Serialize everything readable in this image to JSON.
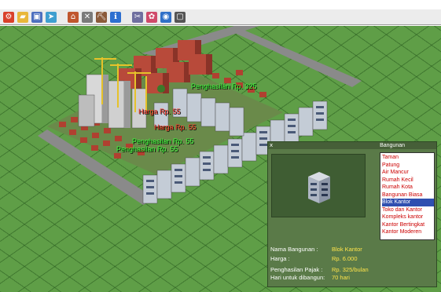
{
  "toolbar": {
    "icons": [
      "settings-icon",
      "folder-icon",
      "save-icon",
      "arrow-icon",
      "house-icon",
      "demolish-icon",
      "pickaxe-icon",
      "info-icon",
      "tools-icon",
      "flower-icon",
      "globe-icon",
      "window-icon"
    ]
  },
  "floating_labels": [
    {
      "text": "Penghasilan Rp. 325",
      "color": "green"
    },
    {
      "text": "Harga Rp. 55",
      "color": "red"
    },
    {
      "text": "Harga Rp. 55",
      "color": "red"
    },
    {
      "text": "Penghasilan Rp. 55",
      "color": "green"
    },
    {
      "text": "Penghasilan Rp. 55",
      "color": "green"
    }
  ],
  "panel": {
    "title": "Bangunan",
    "close": "x",
    "list_items": [
      "Taman",
      "Patung",
      "Air Mancur",
      "Rumah Kecil",
      "Rumah Kota",
      "Bangunan Biasa",
      "Blok Kantor",
      "Toko dan Kantor",
      "Kompleks kantor",
      "Kantor Bertingkat",
      "Kantor Moderen"
    ],
    "selected_index": 6,
    "info": {
      "name_label": "Nama Bangunan :",
      "name_value": "Blok Kantor",
      "price_label": "Harga :",
      "price_value": "Rp. 6.000",
      "tax_label": "Penghasilan Pajak :",
      "tax_value": "Rp. 325/bulan",
      "days_label": "Hari untuk dibangun:",
      "days_value": "70 hari"
    }
  },
  "colors": {
    "grass": "#5f9e47",
    "panel": "#5a7a48",
    "list_text": "#cc0000",
    "list_selected": "#2f4fb0",
    "info_value": "#ffe44a"
  }
}
